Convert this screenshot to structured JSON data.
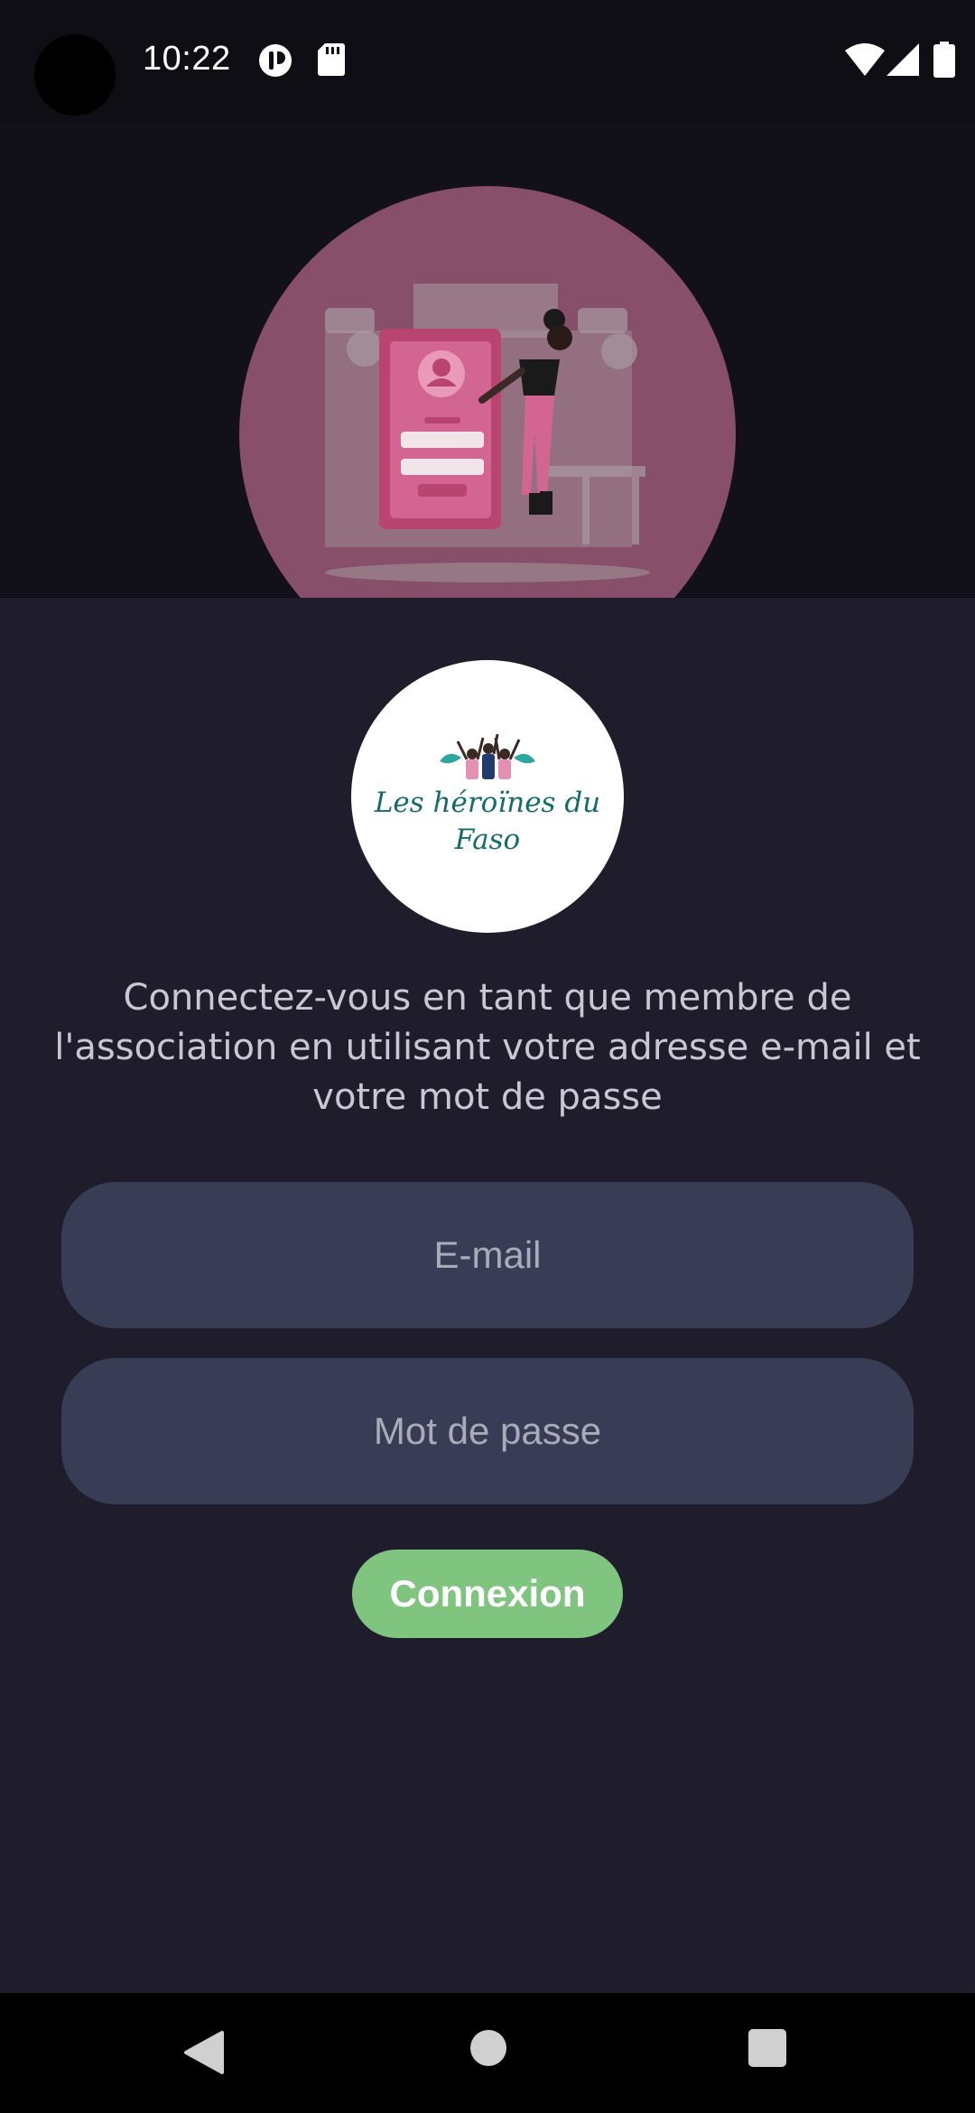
{
  "status_bar": {
    "time": "10:22",
    "icons": [
      "camera-cutout",
      "alert-icon",
      "sd-card-icon",
      "wifi-icon",
      "signal-icon",
      "battery-icon"
    ]
  },
  "logo": {
    "line1": "Les héroïnes du",
    "line2": "Faso"
  },
  "login": {
    "intro": "Connectez-vous en tant que membre de l'association en utilisant votre adresse e-mail et votre mot de passe",
    "email_placeholder": "E-mail",
    "password_placeholder": "Mot de passe",
    "submit_label": "Connexion"
  },
  "nav_bar": {
    "icons": [
      "back-icon",
      "home-icon",
      "recents-icon"
    ]
  },
  "colors": {
    "accent": "#7fc47f",
    "field_bg": "#393c55",
    "panel_bg": "#1f1d2b",
    "hero_circle": "#874f69"
  }
}
